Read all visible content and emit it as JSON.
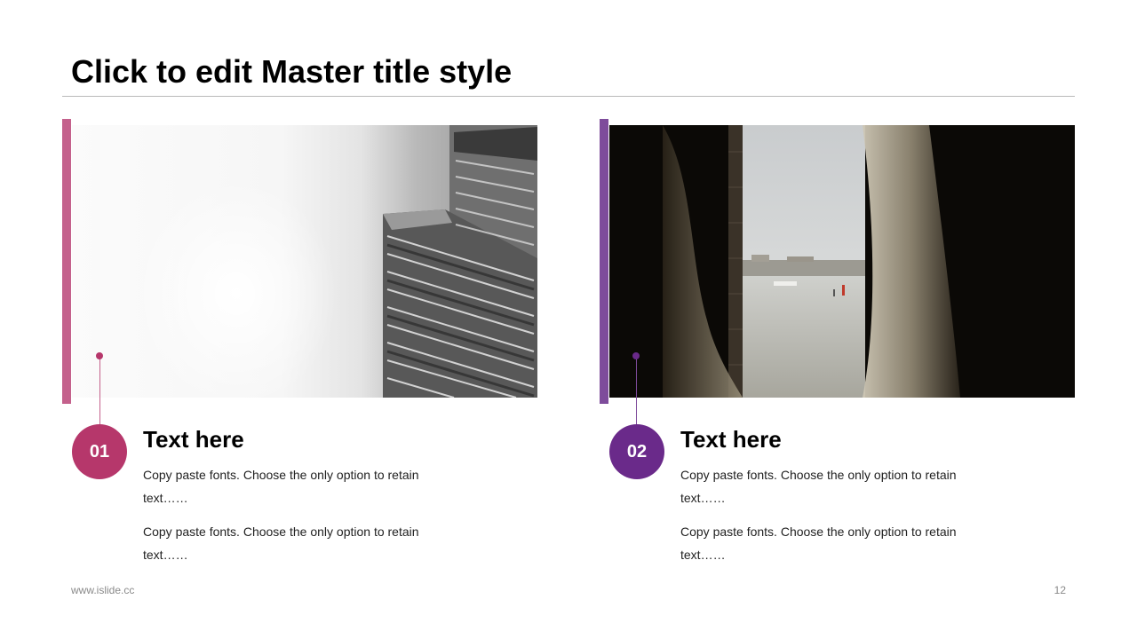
{
  "title": "Click to edit Master title style",
  "colors": {
    "accent_pink": "#c4618c",
    "accent_purple": "#7e4c9b",
    "circle_01": "#b6376b",
    "circle_02": "#6a2a8a",
    "rule": "#b9b9b9"
  },
  "items": [
    {
      "number": "01",
      "heading": "Text here",
      "paragraphs": [
        "Copy paste fonts. Choose the only option to retain text……",
        "Copy paste fonts. Choose the only option to retain text……"
      ],
      "image": "foggy-skyscraper-photo"
    },
    {
      "number": "02",
      "heading": "Text here",
      "paragraphs": [
        "Copy paste fonts. Choose the only option to retain text……",
        "Copy paste fonts. Choose the only option to retain text……"
      ],
      "image": "window-curtain-sea-view-photo"
    }
  ],
  "footer": {
    "website": "www.islide.cc",
    "page_number": "12"
  }
}
